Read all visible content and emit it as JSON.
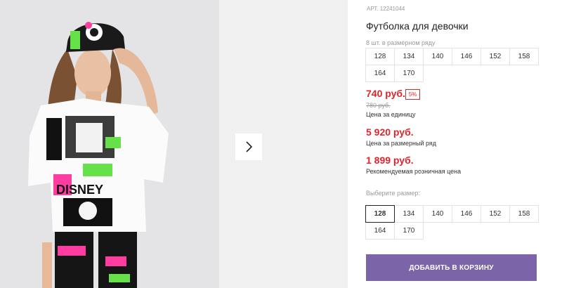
{
  "product": {
    "article": "АРТ. 12241044",
    "title": "Футболка для девочки",
    "pack_label": "8 шт. в размерном ряду",
    "pack_sizes": [
      "128",
      "134",
      "140",
      "146",
      "152",
      "158",
      "164",
      "170"
    ],
    "price_unit": "740 руб.",
    "discount": "5%",
    "old_price": "780 руб.",
    "price_unit_caption": "Цена за единицу",
    "price_pack": "5 920 руб.",
    "price_pack_caption": "Цена за размерный ряд",
    "price_rrp": "1 899 руб.",
    "price_rrp_caption": "Рекомендуемая розничная цена",
    "select_size_label": "Выберите размер:",
    "select_sizes": [
      "128",
      "134",
      "140",
      "146",
      "152",
      "158",
      "164",
      "170"
    ],
    "selected_size": "128",
    "add_to_cart": "ДОБАВИТЬ В КОРЗИНУ"
  },
  "gallery": {
    "photo_print_text": "DISNEY",
    "next_icon": "chevron-right-icon"
  },
  "colors": {
    "price": "#e3242b",
    "button": "#7b64a8",
    "neon_green": "#67e14a",
    "neon_pink": "#ff3da0"
  }
}
